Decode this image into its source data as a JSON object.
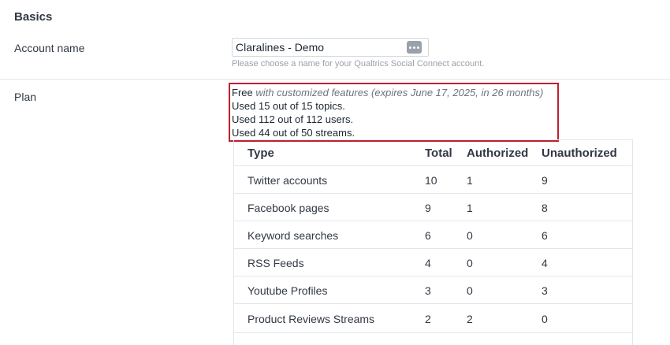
{
  "basics": {
    "title": "Basics",
    "account_label": "Account name",
    "account_value": "Claralines - Demo",
    "account_help": "Please choose a name for your Qualtrics Social Connect account."
  },
  "plan": {
    "label": "Plan",
    "tier": "Free",
    "tier_detail": "with customized features (expires June 17, 2025, in 26 months)",
    "topics_usage": "Used 15 out of 15 topics.",
    "users_usage": "Used 112 out of 112 users.",
    "streams_usage": "Used 44 out of 50 streams."
  },
  "table": {
    "headers": [
      "Type",
      "Total",
      "Authorized",
      "Unauthorized"
    ],
    "rows": [
      [
        "Twitter accounts",
        "10",
        "1",
        "9"
      ],
      [
        "Facebook pages",
        "9",
        "1",
        "8"
      ],
      [
        "Keyword searches",
        "6",
        "0",
        "6"
      ],
      [
        "RSS Feeds",
        "4",
        "0",
        "4"
      ],
      [
        "Youtube Profiles",
        "3",
        "0",
        "3"
      ],
      [
        "Product Reviews Streams",
        "2",
        "2",
        "0"
      ]
    ]
  },
  "colors": {
    "highlight": "#c0202f",
    "divider": "#e3e6e9",
    "help_text": "#9aa1ab"
  }
}
